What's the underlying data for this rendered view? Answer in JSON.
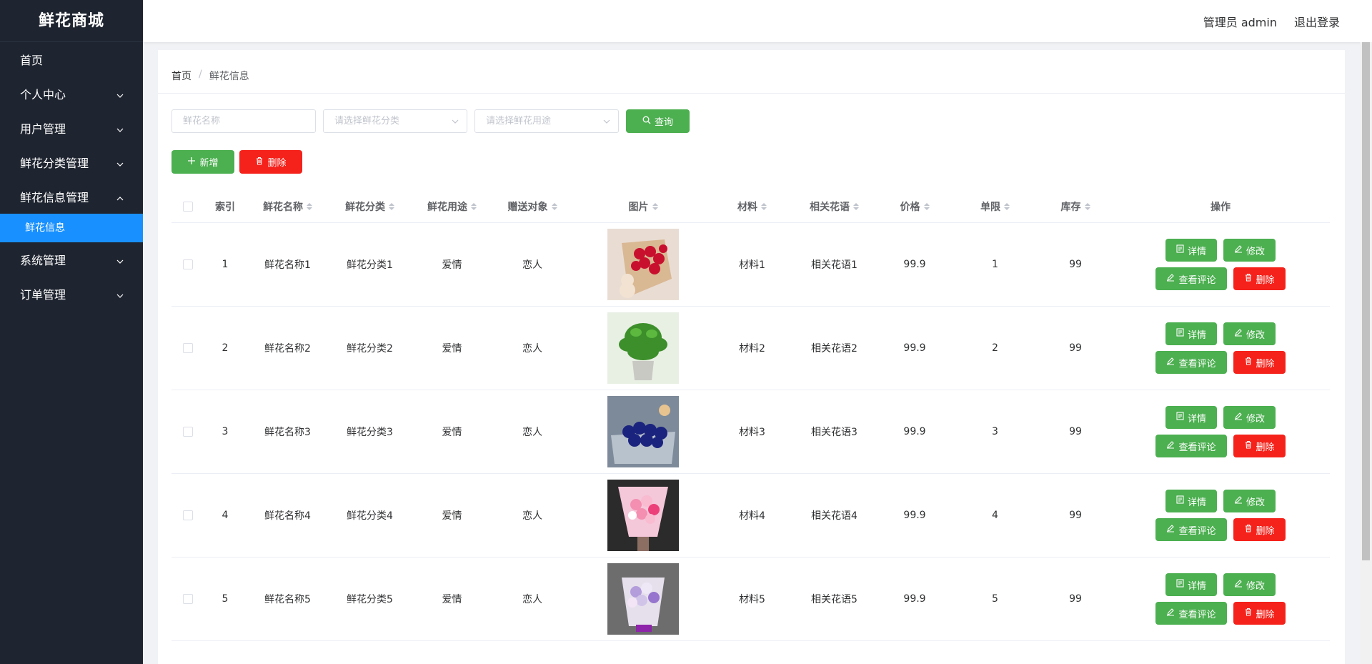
{
  "app": {
    "title": "鲜花商城"
  },
  "sidebar": {
    "items": [
      {
        "label": "首页",
        "has_children": false
      },
      {
        "label": "个人中心",
        "has_children": true
      },
      {
        "label": "用户管理",
        "has_children": true
      },
      {
        "label": "鲜花分类管理",
        "has_children": true
      },
      {
        "label": "鲜花信息管理",
        "has_children": true,
        "open": true,
        "children": [
          {
            "label": "鲜花信息",
            "active": true
          }
        ]
      },
      {
        "label": "系统管理",
        "has_children": true
      },
      {
        "label": "订单管理",
        "has_children": true
      }
    ]
  },
  "header": {
    "user": "管理员 admin",
    "logout": "退出登录"
  },
  "breadcrumb": {
    "home": "首页",
    "sep": "/",
    "current": "鲜花信息"
  },
  "filters": {
    "name_placeholder": "鲜花名称",
    "category_placeholder": "请选择鲜花分类",
    "usage_placeholder": "请选择鲜花用途",
    "query_label": "查询"
  },
  "actions": {
    "add_label": "新增",
    "delete_label": "删除"
  },
  "table": {
    "headers": [
      "索引",
      "鲜花名称",
      "鲜花分类",
      "鲜花用途",
      "赠送对象",
      "图片",
      "材料",
      "相关花语",
      "价格",
      "单限",
      "库存",
      "操作"
    ],
    "rows": [
      {
        "index": "1",
        "name": "鲜花名称1",
        "category": "鲜花分类1",
        "usage": "爱情",
        "target": "恋人",
        "image": "red-roses",
        "material": "材料1",
        "language": "相关花语1",
        "price": "99.9",
        "limit": "1",
        "stock": "99"
      },
      {
        "index": "2",
        "name": "鲜花名称2",
        "category": "鲜花分类2",
        "usage": "爱情",
        "target": "恋人",
        "image": "green-potted-plant",
        "material": "材料2",
        "language": "相关花语2",
        "price": "99.9",
        "limit": "2",
        "stock": "99"
      },
      {
        "index": "3",
        "name": "鲜花名称3",
        "category": "鲜花分类3",
        "usage": "爱情",
        "target": "恋人",
        "image": "blue-roses",
        "material": "材料3",
        "language": "相关花语3",
        "price": "99.9",
        "limit": "3",
        "stock": "99"
      },
      {
        "index": "4",
        "name": "鲜花名称4",
        "category": "鲜花分类4",
        "usage": "爱情",
        "target": "恋人",
        "image": "pink-bouquet",
        "material": "材料4",
        "language": "相关花语4",
        "price": "99.9",
        "limit": "4",
        "stock": "99"
      },
      {
        "index": "5",
        "name": "鲜花名称5",
        "category": "鲜花分类5",
        "usage": "爱情",
        "target": "恋人",
        "image": "purple-bouquet",
        "material": "材料5",
        "language": "相关花语5",
        "price": "99.9",
        "limit": "5",
        "stock": "99"
      }
    ],
    "row_ops": {
      "detail": "详情",
      "edit": "修改",
      "comments": "查看评论",
      "delete": "删除"
    }
  },
  "colors": {
    "sidebar_bg": "#1f2530",
    "active_blue": "#1890ff",
    "green": "#4caf50",
    "red": "#f5221b"
  }
}
